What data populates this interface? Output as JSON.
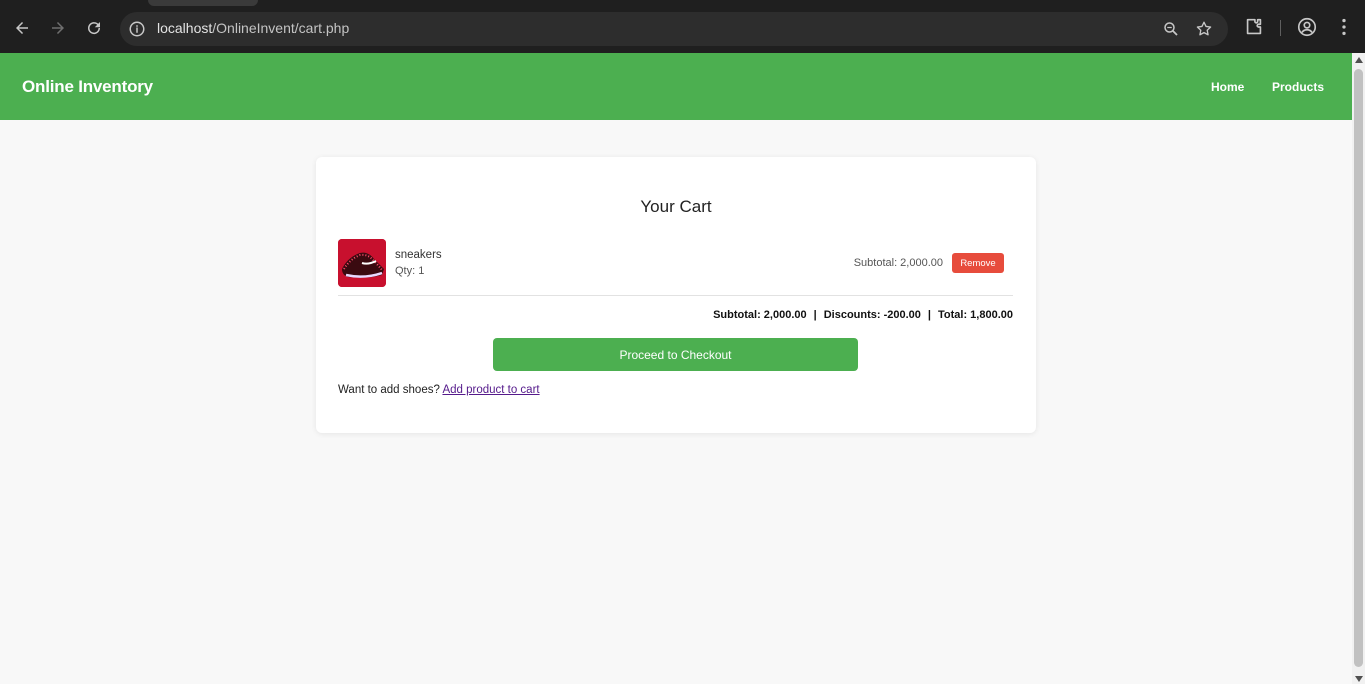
{
  "browser": {
    "url_host": "localhost",
    "url_path": "/OnlineInvent/cart.php"
  },
  "navbar": {
    "brand": "Online Inventory",
    "links": [
      {
        "label": "Home"
      },
      {
        "label": "Products"
      }
    ],
    "color": "#4caf50"
  },
  "cart": {
    "title": "Your Cart",
    "items": [
      {
        "name": "sneakers",
        "qty": "Qty: 1",
        "subtotal": "Subtotal: 2,000.00",
        "remove_label": "Remove"
      }
    ],
    "summary": {
      "subtotal": "Subtotal: 2,000.00",
      "discounts": "Discounts: -200.00",
      "total": "Total: 1,800.00",
      "separator": "|"
    },
    "checkout_label": "Proceed to Checkout",
    "add_prompt": "Want to add shoes?",
    "add_link": "Add product to cart"
  },
  "colors": {
    "accent": "#4caf50",
    "danger": "#e74c3c"
  }
}
